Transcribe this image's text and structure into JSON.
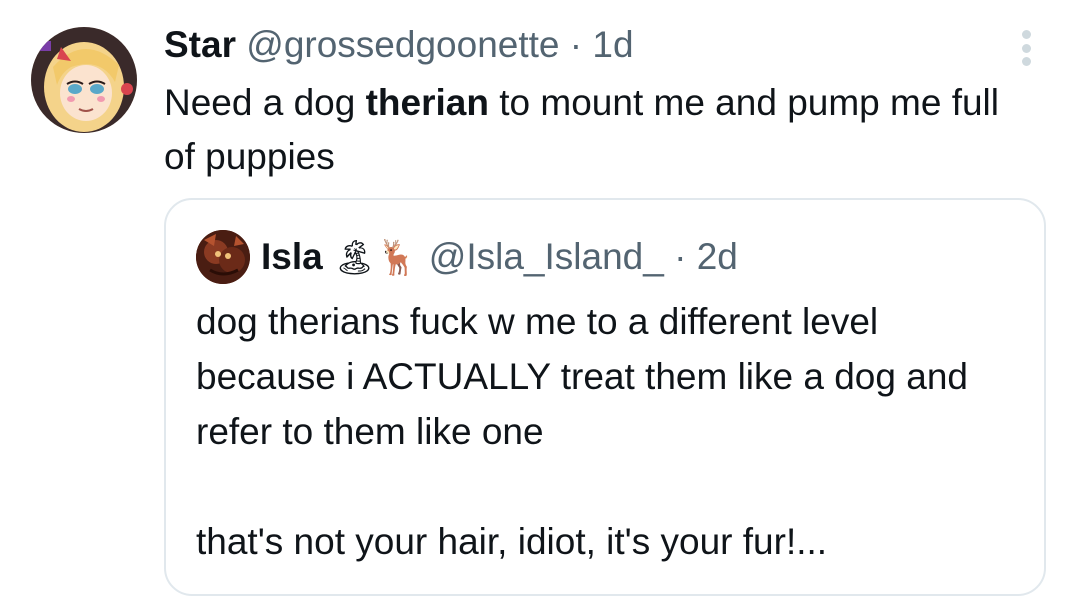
{
  "tweet": {
    "author_name": "Star",
    "author_handle": "@grossedgoonette",
    "separator": "·",
    "time": "1d",
    "text_before": "Need a dog ",
    "text_bold": "therian",
    "text_after": " to mount me and pump me full of puppies"
  },
  "quoted": {
    "author_name": "Isla",
    "emoji_1": "🏝",
    "emoji_2": "🦌",
    "author_handle": "@Isla_Island_",
    "separator": "·",
    "time": "2d",
    "text": "dog therians fuck w me to a different level because i ACTUALLY treat them like a dog and refer to them like one\n\nthat's not your hair, idiot, it's your fur!..."
  },
  "icons": {
    "more": "more-options-icon"
  },
  "colors": {
    "text_primary": "#0f1419",
    "text_secondary": "#536471",
    "border": "#e1e8ed",
    "dots": "#cfd9de"
  }
}
